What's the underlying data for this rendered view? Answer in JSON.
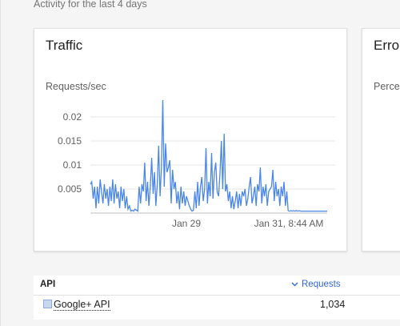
{
  "header": {
    "subtitle": "Activity for the last 4 days"
  },
  "cards": {
    "traffic": {
      "title": "Traffic",
      "metric": "Requests/sec"
    },
    "errors": {
      "title": "Errors",
      "metric": "Percent"
    }
  },
  "chart_data": {
    "type": "line",
    "ylabel": "Requests/sec",
    "ylim": [
      0,
      0.025
    ],
    "yticks": [
      "0.02",
      "0.015",
      "0.01",
      "0.005"
    ],
    "ytick_values": [
      0.02,
      0.015,
      0.01,
      0.005
    ],
    "xticks": [
      "Jan 29",
      "Jan 31, 8:44 AM"
    ],
    "grid": true,
    "color": "#4a86e8",
    "values": [
      0.006,
      0.0065,
      0.003,
      0.0055,
      0.001,
      0.0055,
      0.002,
      0.007,
      0.0045,
      0.002,
      0.006,
      0.003,
      0.005,
      0.0015,
      0.0055,
      0.0025,
      0.007,
      0.002,
      0.006,
      0.003,
      0.0045,
      0.001,
      0.0055,
      0.0025,
      0.005,
      0.001,
      0.0035,
      0.0008,
      0.0015,
      0.0004,
      0.0006,
      0.0004,
      0.0008,
      0.0006,
      0.0004,
      0.0055,
      0.002,
      0.006,
      0.0045,
      0.0105,
      0.0025,
      0.0065,
      0.0015,
      0.0055,
      0.0115,
      0.004,
      0.0085,
      0.0015,
      0.006,
      0.014,
      0.0035,
      0.0095,
      0.0235,
      0.0055,
      0.0145,
      0.0085,
      0.0095,
      0.011,
      0.002,
      0.009,
      0.005,
      0.0065,
      0.002,
      0.0045,
      0.0008,
      0.0055,
      0.002,
      0.0045,
      0.0015,
      0.0035,
      0.0025,
      0.0015,
      0.0008,
      0.0004,
      0.0006,
      0.0045,
      0.001,
      0.0065,
      0.0015,
      0.0055,
      0.0075,
      0.0025,
      0.005,
      0.0135,
      0.002,
      0.0065,
      0.0035,
      0.0125,
      0.003,
      0.0085,
      0.0105,
      0.0045,
      0.0035,
      0.008,
      0.015,
      0.005,
      0.0165,
      0.0045,
      0.006,
      0.0025,
      0.0045,
      0.001,
      0.0035,
      0.0008,
      0.0025,
      0.0045,
      0.001,
      0.004,
      0.0015,
      0.0045,
      0.0035,
      0.005,
      0.0015,
      0.003,
      0.0055,
      0.0075,
      0.002,
      0.0035,
      0.0055,
      0.0015,
      0.006,
      0.0045,
      0.0095,
      0.002,
      0.0055,
      0.0035,
      0.006,
      0.0015,
      0.0045,
      0.005,
      0.0055,
      0.009,
      0.0025,
      0.0065,
      0.0035,
      0.005,
      0.0015,
      0.0055,
      0.0035,
      0.0065,
      0.0015,
      0.0045,
      0.0005,
      0.0004,
      0.0005,
      0.0004,
      0.0005,
      0.0004,
      0.0005,
      0.0004,
      0.0005,
      0.0004,
      0.0004,
      0.0004,
      0.0004,
      0.0004,
      0.0004,
      0.0004,
      0.0004,
      0.0004,
      0.0004,
      0.0004,
      0.0004,
      0.0004,
      0.0004,
      0.0004,
      0.0004,
      0.0004,
      0.0004,
      0.0004,
      0.0004
    ]
  },
  "table": {
    "col_api": "API",
    "col_requests": "Requests",
    "sort_icon": "chevron-down-icon",
    "rows": [
      {
        "api": "Google+ API",
        "requests": "1,034"
      }
    ]
  }
}
